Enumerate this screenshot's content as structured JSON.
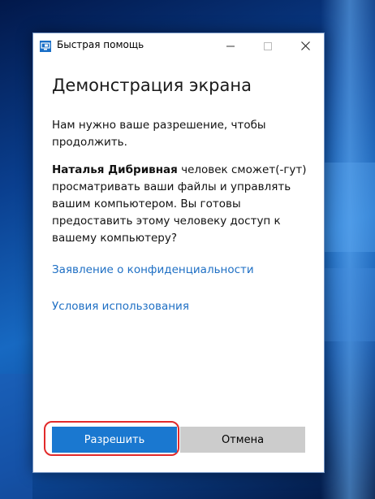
{
  "window": {
    "title": "Быстрая помощь",
    "icon": "quick-assist-icon",
    "controls": {
      "minimize_icon": "minimize-icon",
      "maximize_icon": "maximize-icon",
      "close_icon": "close-icon"
    }
  },
  "content": {
    "heading": "Демонстрация экрана",
    "permission_text": "Нам нужно ваше разрешение, чтобы продолжить.",
    "user_name": "Наталья Дибривная",
    "access_text": " человек сможет(-гут) просматривать ваши файлы и управлять вашим компьютером. Вы готовы предоставить этому человеку доступ к вашему компьютеру?",
    "privacy_link": "Заявление о конфиденциальности",
    "terms_link": "Условия использования"
  },
  "buttons": {
    "allow_label": "Разрешить",
    "cancel_label": "Отмена"
  },
  "colors": {
    "accent": "#1a78d0",
    "link": "#1e6fc4",
    "highlight": "#e22a2a",
    "cancel_bg": "#cccccc"
  }
}
